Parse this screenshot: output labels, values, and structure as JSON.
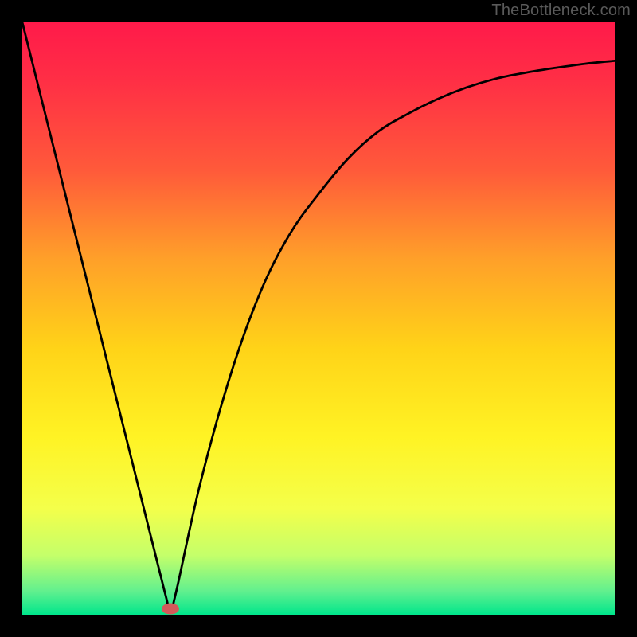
{
  "watermark": "TheBottleneck.com",
  "chart_data": {
    "type": "line",
    "title": "",
    "xlabel": "",
    "ylabel": "",
    "xlim": [
      0,
      100
    ],
    "ylim": [
      0,
      100
    ],
    "grid": false,
    "legend": "none",
    "series": [
      {
        "name": "bottleneck-curve",
        "x": [
          0,
          5,
          10,
          15,
          20,
          24,
          25,
          26,
          30,
          35,
          40,
          45,
          50,
          55,
          60,
          65,
          70,
          75,
          80,
          85,
          90,
          95,
          100
        ],
        "y": [
          100,
          80,
          60,
          40,
          20,
          4,
          1,
          4,
          22,
          40,
          54,
          64,
          71,
          77,
          81.5,
          84.5,
          87,
          89,
          90.5,
          91.5,
          92.3,
          93,
          93.5
        ]
      }
    ],
    "marker": {
      "name": "optimal-point",
      "x": 25,
      "y": 1,
      "color": "#d35a5a",
      "rx": 11,
      "ry": 7
    },
    "gradient_stops": [
      {
        "pos": 0.0,
        "color": "#ff1a4a"
      },
      {
        "pos": 0.1,
        "color": "#ff2f45"
      },
      {
        "pos": 0.25,
        "color": "#ff5a3a"
      },
      {
        "pos": 0.4,
        "color": "#ffa029"
      },
      {
        "pos": 0.55,
        "color": "#ffd318"
      },
      {
        "pos": 0.7,
        "color": "#fff324"
      },
      {
        "pos": 0.82,
        "color": "#f4ff4a"
      },
      {
        "pos": 0.9,
        "color": "#c4ff6a"
      },
      {
        "pos": 0.96,
        "color": "#62f08e"
      },
      {
        "pos": 1.0,
        "color": "#00e68c"
      }
    ]
  }
}
